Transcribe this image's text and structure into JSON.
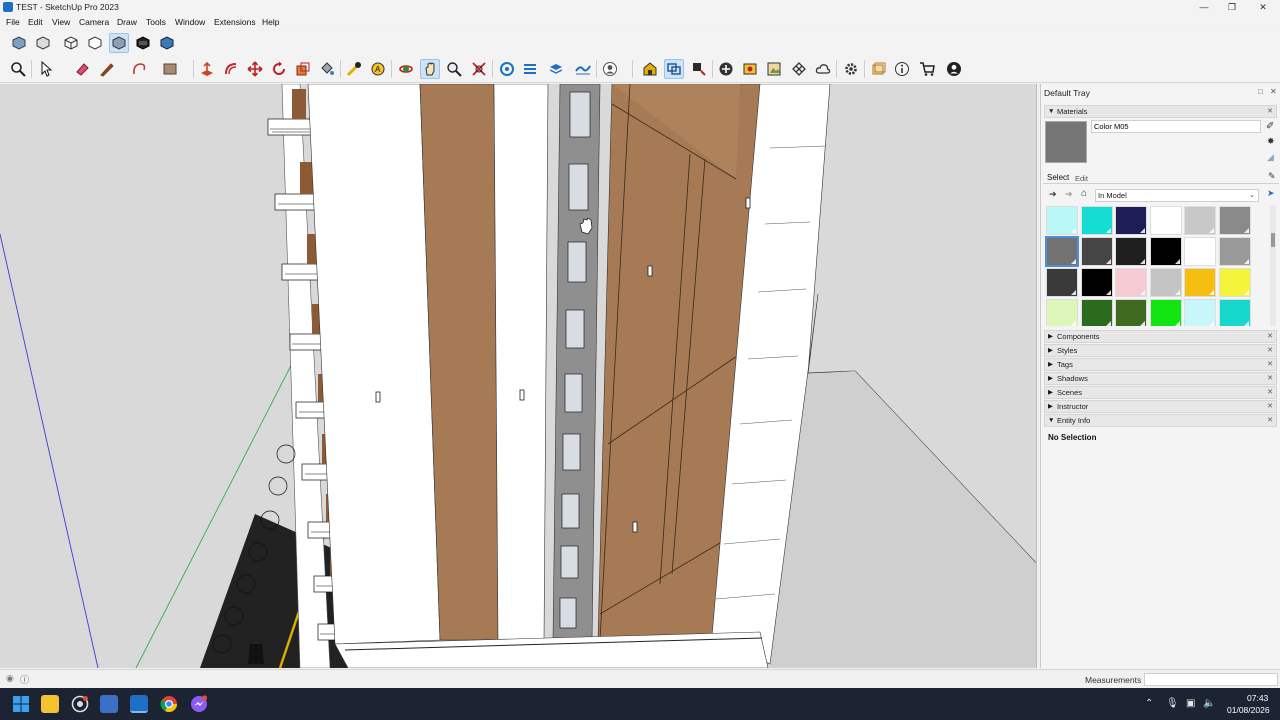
{
  "window": {
    "title": "TEST - SketchUp Pro 2023",
    "controls": [
      "minimize",
      "maximize",
      "close"
    ]
  },
  "menu": [
    "File",
    "Edit",
    "View",
    "Camera",
    "Draw",
    "Tools",
    "Window",
    "Extensions",
    "Help"
  ],
  "toolbar_styles": [
    "xray-icon",
    "back-edges-icon",
    "wireframe-icon",
    "hidden-line-icon",
    "shaded-icon",
    "shaded-textures-icon",
    "monochrome-icon"
  ],
  "toolbar_main": [
    "search-icon",
    "select-icon",
    "eraser-icon",
    "pencil-line-icon",
    "shape-tool-icon",
    "rectangle-icon",
    "push-pull-icon",
    "offset-icon",
    "move-icon",
    "rotate-icon",
    "scale-icon",
    "paint-bucket-icon",
    "tape-measure-icon",
    "text-icon",
    "orbit-icon",
    "pan-icon",
    "zoom-icon",
    "zoom-extents-icon",
    "section-plane-icon",
    "layers-icon",
    "tags-icon",
    "sandbox-icon",
    "user-icon",
    "warehouse-icon",
    "components-icon",
    "extension-icon",
    "add-location-icon",
    "geo-icon",
    "photo-texture-icon",
    "mesh-icon",
    "cloud-icon",
    "settings-icon",
    "window-icon",
    "info-icon",
    "cart-icon",
    "account-icon"
  ],
  "tray": {
    "title": "Default Tray",
    "materials": {
      "header": "Materials",
      "current_color_name": "Color M05",
      "current_color": "#757575",
      "tabs": [
        "Select",
        "Edit"
      ],
      "library": "In Model",
      "swatches": [
        "#b9f7f7",
        "#16ddd4",
        "#1e1d56",
        "#ffffff",
        "#c8c8c8",
        "#8a8a8a",
        "#727272",
        "#454545",
        "#1f1f1f",
        "#000000",
        "#ffffff",
        "#9a9a9a",
        "#3a3a3a",
        "#000000",
        "#f6cad3",
        "#c4c4c4",
        "#f4bd0f",
        "#f4f43a",
        "#dcf7b9",
        "#2b6b1d",
        "#3f6a1f",
        "#12e612",
        "#c8f7fb",
        "#17d8cc"
      ],
      "selected_swatch": 6
    },
    "collapsed_panels": [
      "Components",
      "Styles",
      "Tags",
      "Shadows",
      "Scenes",
      "Instructor"
    ],
    "entity_info": {
      "header": "Entity Info",
      "text": "No Selection"
    }
  },
  "status": {
    "measurements_label": "Measurements",
    "measurements_value": ""
  },
  "taskbar": {
    "apps": [
      "windows-start",
      "file-explorer",
      "chrome-alt",
      "tablet-app",
      "sketchup",
      "chrome",
      "messenger"
    ],
    "time": "07:43",
    "date": "01/08/2026"
  },
  "colors": {
    "accent": "#1f6fc5",
    "wood_panel": "#a57a55",
    "sky": "#d9d9d9"
  }
}
